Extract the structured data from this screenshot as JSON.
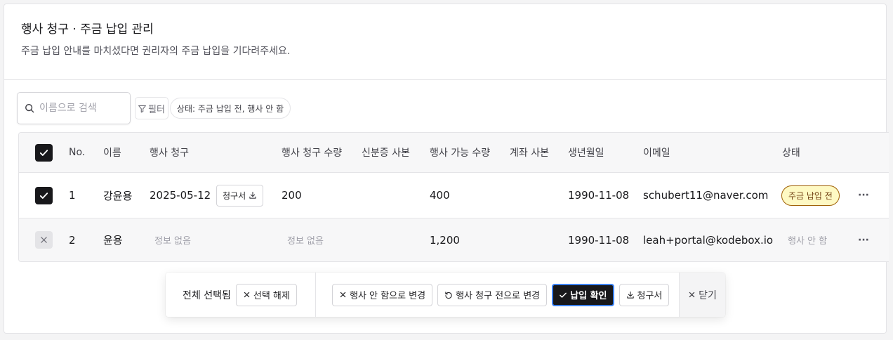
{
  "header": {
    "title": "행사 청구 · 주금 납입 관리",
    "description": "주금 납입 안내를 마치셨다면 권리자의 주금 납입을 기다려주세요."
  },
  "toolbar": {
    "search_placeholder": "이름으로 검색",
    "filter_label": "필터",
    "filter_chip": "상태: 주금 납입 전, 행사 안 함"
  },
  "table": {
    "columns": [
      "No.",
      "이름",
      "행사 청구",
      "행사 청구 수량",
      "신분증 사본",
      "행사 가능 수량",
      "계좌 사본",
      "생년월일",
      "이메일",
      "상태"
    ],
    "rows": [
      {
        "no": "1",
        "name": "강윤용",
        "claim_date": "2025-05-12",
        "invoice_button": "청구서",
        "claim_qty": "200",
        "available_qty": "400",
        "birth": "1990-11-08",
        "email": "schubert11@naver.com",
        "status": "주금 납입 전",
        "checked": true
      },
      {
        "no": "2",
        "name": "윤용",
        "claim_date": "정보 없음",
        "claim_qty": "정보 없음",
        "available_qty": "1,200",
        "birth": "1990-11-08",
        "email": "leah+portal@kodebox.io",
        "status": "행사 안 함",
        "checked": false
      }
    ]
  },
  "actionbar": {
    "selected_label": "전체 선택됨",
    "deselect": "선택 해제",
    "set_no_exercise": "행사 안 함으로 변경",
    "set_before_claim": "행사 청구 전으로 변경",
    "confirm_payment": "납입 확인",
    "invoice": "청구서",
    "close": "닫기"
  },
  "colors": {
    "primary": "#18181b",
    "focus_ring": "#3b82f6",
    "badge_bg": "#fef9c3",
    "badge_border": "#a16207"
  }
}
